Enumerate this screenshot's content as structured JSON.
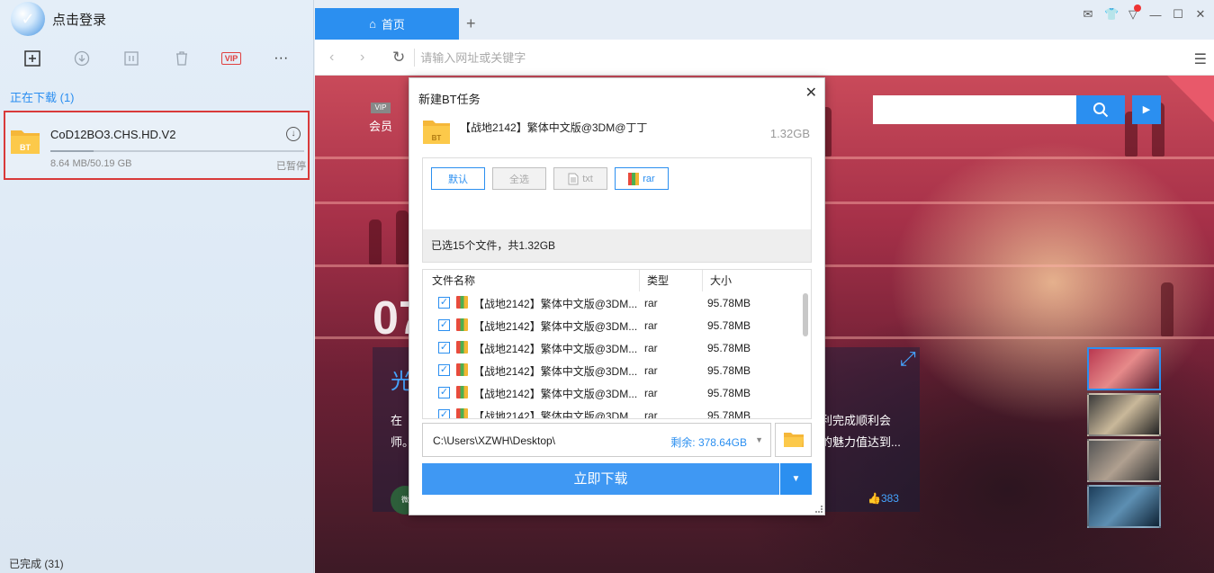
{
  "sidebar": {
    "login_text": "点击登录",
    "toolbar": {
      "vip_label": "VIP",
      "more_label": "···"
    },
    "downloading_title": "正在下载 (1)",
    "task": {
      "name": "CoD12BO3.CHS.HD.V2",
      "size": "8.64 MB/50.19 GB",
      "status": "已暂停",
      "progress": 0.17
    },
    "completed_title": "已完成 (31)"
  },
  "browser": {
    "tab_label": "首页",
    "address_placeholder": "请输入网址或关键字",
    "member_label": "会员",
    "member_badge": "VIP",
    "big_number": "07",
    "card_title": "光",
    "card_desc_left_1": "在",
    "card_desc_left_2": "师。",
    "card_desc_right_1": "利完成顺利会",
    "card_desc_right_2": "的魅力值达到...",
    "like_count": "383",
    "avatar_text": "微"
  },
  "dialog": {
    "title": "新建BT任务",
    "torrent_name": "【战地2142】繁体中文版@3DM@丁丁",
    "torrent_size": "1.32GB",
    "filters": [
      {
        "label": "默认"
      },
      {
        "label": "全选"
      },
      {
        "label": "txt"
      },
      {
        "label": "rar"
      }
    ],
    "summary": "已选15个文件，共1.32GB",
    "columns": [
      "文件名称",
      "类型",
      "大小"
    ],
    "files": [
      {
        "name": "【战地2142】繁体中文版@3DM...",
        "type": "rar",
        "size": "95.78MB"
      },
      {
        "name": "【战地2142】繁体中文版@3DM...",
        "type": "rar",
        "size": "95.78MB"
      },
      {
        "name": "【战地2142】繁体中文版@3DM...",
        "type": "rar",
        "size": "95.78MB"
      },
      {
        "name": "【战地2142】繁体中文版@3DM...",
        "type": "rar",
        "size": "95.78MB"
      },
      {
        "name": "【战地2142】繁体中文版@3DM...",
        "type": "rar",
        "size": "95.78MB"
      },
      {
        "name": "【战地2142】繁体中文版@3DM...",
        "type": "rar",
        "size": "95.78MB"
      }
    ],
    "save_path": "C:\\Users\\XZWH\\Desktop\\",
    "free_space": "剩余: 378.64GB",
    "download_button": "立即下载"
  },
  "colors": {
    "accent": "#2b8ff0",
    "highlight_border": "#d93a3a"
  }
}
